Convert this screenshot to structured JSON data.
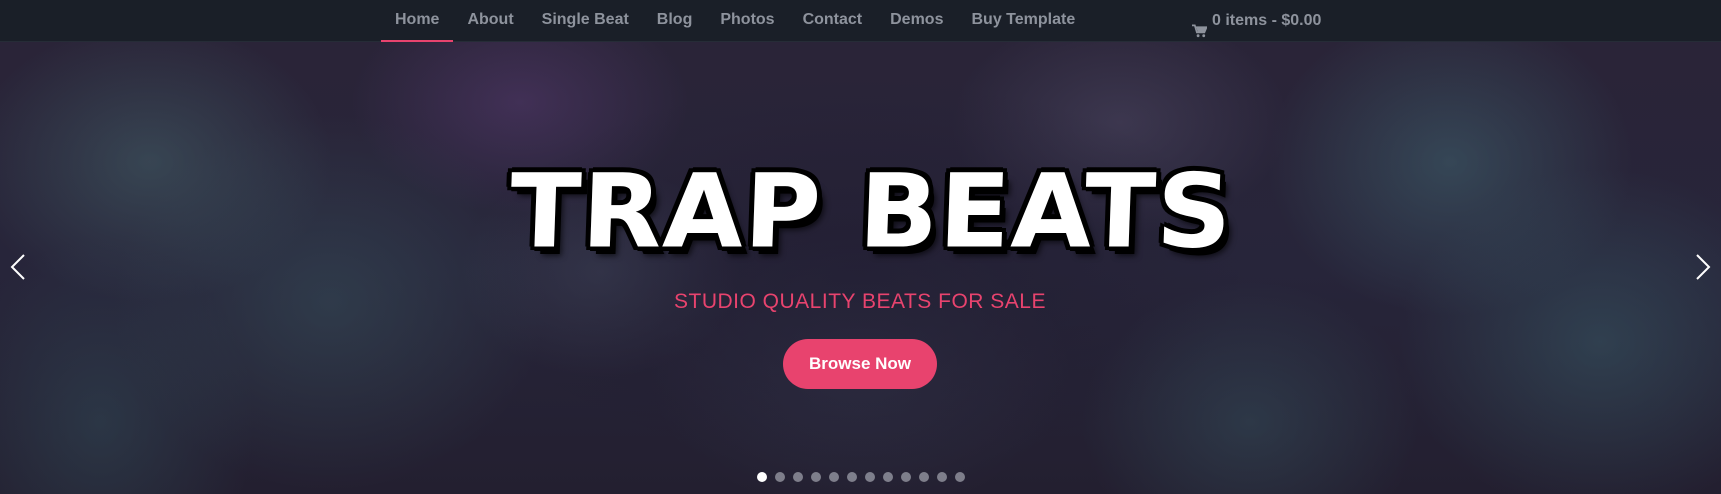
{
  "nav": {
    "items": [
      {
        "label": "Home",
        "active": true
      },
      {
        "label": "About",
        "active": false
      },
      {
        "label": "Single Beat",
        "active": false
      },
      {
        "label": "Blog",
        "active": false
      },
      {
        "label": "Photos",
        "active": false
      },
      {
        "label": "Contact",
        "active": false
      },
      {
        "label": "Demos",
        "active": false
      },
      {
        "label": "Buy Template",
        "active": false
      }
    ],
    "cart_label": "0 items - $0.00",
    "cart_icon": "shopping-cart-icon"
  },
  "hero": {
    "title": "TRAP BEATS",
    "subtitle": "STUDIO QUALITY BEATS FOR SALE",
    "button_label": "Browse Now",
    "prev_icon": "chevron-left-icon",
    "next_icon": "chevron-right-icon",
    "slide_count": 12,
    "active_slide": 1
  },
  "colors": {
    "accent": "#e8436e",
    "nav_background": "#1a1f28",
    "nav_text": "#8e939d",
    "title": "#ffffff"
  }
}
